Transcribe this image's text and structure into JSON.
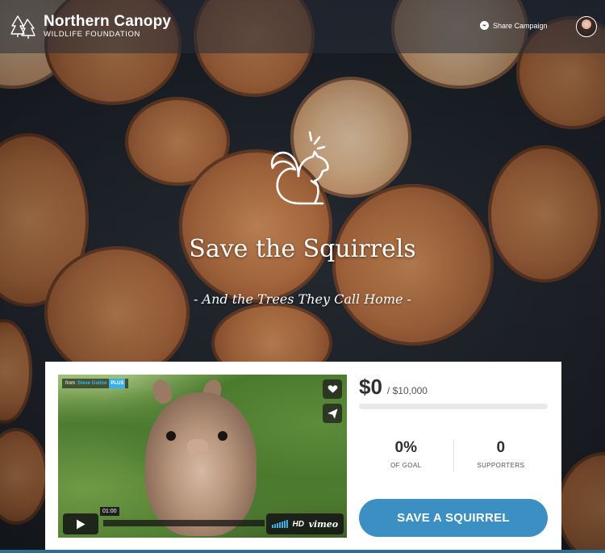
{
  "header": {
    "brand_name": "Northern Canopy",
    "brand_sub": "WILDLIFE FOUNDATION",
    "share_label": "Share Campaign",
    "brand_icon": "pine-trees-icon",
    "share_icon": "messenger-icon"
  },
  "hero": {
    "icon": "squirrel-icon",
    "title": "Save the Squirrels",
    "subtitle": "- And the Trees They Call Home -"
  },
  "video": {
    "from_label": "from",
    "author": "Steve Gatine",
    "plus_badge": "PLUS",
    "time": "01:00",
    "hd_label": "HD",
    "provider": "vimeo",
    "progress": 0
  },
  "funding": {
    "raised": "$0",
    "goal": "/ $10,000",
    "percent_value": 0,
    "percent": "0%",
    "percent_label": "OF GOAL",
    "supporters": "0",
    "supporters_label": "SUPPORTERS"
  },
  "cta": {
    "label": "SAVE A SQUIRREL"
  },
  "colors": {
    "accent": "#3b8fc2",
    "vimeo_blue": "#39b0ea",
    "text_dark": "#2f2f2f"
  }
}
